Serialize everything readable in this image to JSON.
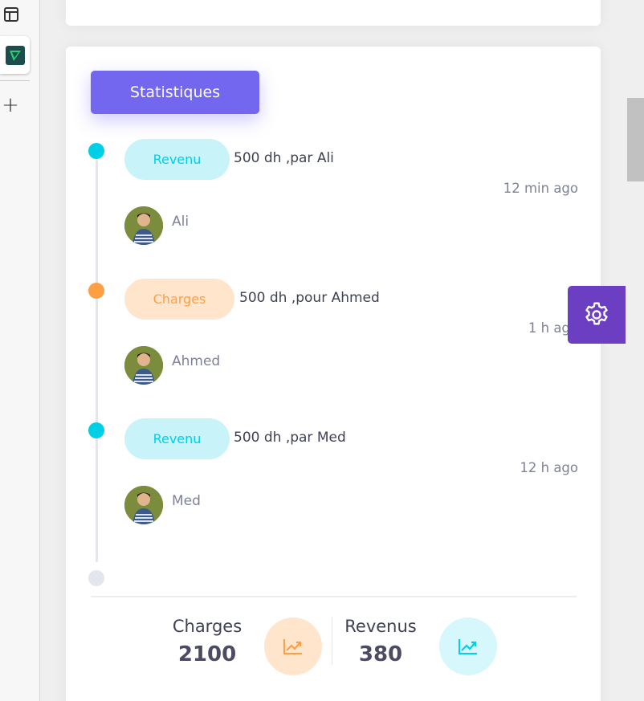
{
  "timeline": {
    "button_label": "Statistiques",
    "items": [
      {
        "badge": "Revenu",
        "description": "500 dh ,par Ali",
        "time": "12 min ago",
        "person": "Ali"
      },
      {
        "badge": "Charges",
        "description": "500 dh ,pour Ahmed",
        "time": "1 h ago",
        "person": "Ahmed"
      },
      {
        "badge": "Revenu",
        "description": "500 dh ,par Med",
        "time": "12 h ago",
        "person": "Med"
      }
    ]
  },
  "summary": {
    "charges_label": "Charges",
    "charges_value": "2100",
    "revenus_label": "Revenus",
    "revenus_value": "380"
  },
  "icons": {
    "layout": "layout-icon",
    "app": "app-logo-icon",
    "add": "plus-icon",
    "trend": "trending-up-icon",
    "settings": "gear-icon"
  },
  "colors": {
    "primary": "#7367f0",
    "cyan": "#00cfe8",
    "orange": "#ff9f43",
    "settings_bg": "#6c3ec2"
  }
}
